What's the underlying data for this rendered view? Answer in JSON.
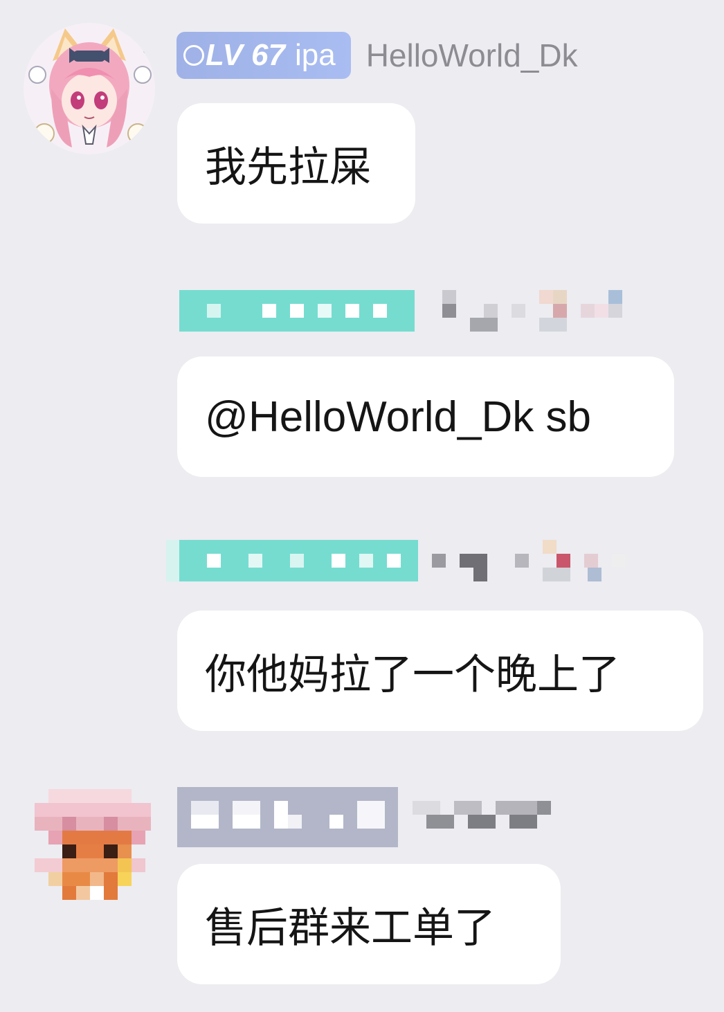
{
  "messages": [
    {
      "avatar": "anime-girl-avatar",
      "badge": {
        "level": "LV 67",
        "role": "ipa"
      },
      "sender": "HelloWorld_Dk",
      "text": "我先拉屎"
    },
    {
      "avatar": "",
      "badge": null,
      "sender": "",
      "text": "@HelloWorld_Dk sb"
    },
    {
      "avatar": "",
      "badge": null,
      "sender": "",
      "text": "你他妈拉了一个晚上了"
    },
    {
      "avatar": "pixelated-avatar",
      "badge": null,
      "sender": "",
      "text": "售后群来工单了"
    }
  ],
  "colors": {
    "background": "#ececf1",
    "bubble": "#ffffff",
    "badge": "#a4b7ee",
    "teal_badge": "#76dcd0",
    "gray_badge": "#b2b6c8",
    "name_text": "#8c8c92"
  }
}
